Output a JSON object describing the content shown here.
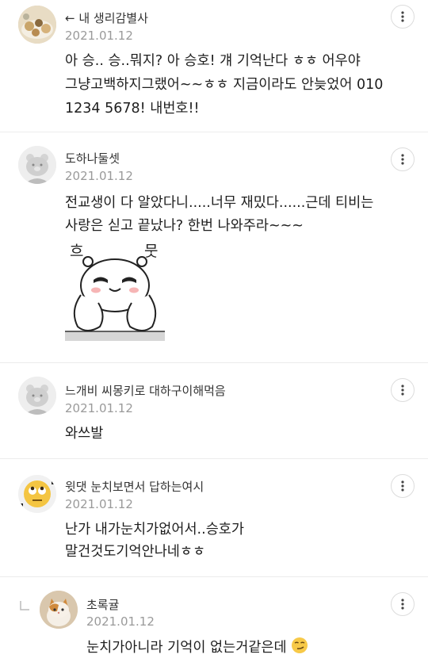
{
  "comments": [
    {
      "author": "← 내 생리감별사",
      "date": "2021.01.12",
      "lines": [
        "아 승.. 승..뭐지? 아 승호! 걔 기억난다 ㅎㅎ 어우야",
        "그냥고백하지그랬어~~ㅎㅎ 지금이라도 안늦었어 010",
        "1234 5678! 내번호!!"
      ]
    },
    {
      "author": "도하나둘셋",
      "date": "2021.01.12",
      "lines": [
        "전교생이 다 알았다니.....너무 재밌다......근데 티비는",
        "사랑은 싣고 끝났나? 한번 나와주라~~~"
      ],
      "sticker_text": [
        "흐",
        "뭇"
      ]
    },
    {
      "author": "느개비 씨몽키로 대하구이해먹음",
      "date": "2021.01.12",
      "lines": [
        "와쓰발"
      ]
    },
    {
      "author": "윗댓 눈치보면서 답하는여시",
      "date": "2021.01.12",
      "lines": [
        "난가 내가눈치가없어서..승호가",
        "말건것도기억안나네ㅎㅎ"
      ]
    },
    {
      "author": "초록귤",
      "date": "2021.01.12",
      "lines": [
        "눈치가아니라 기억이 없는거같은데"
      ],
      "is_reply": true
    }
  ]
}
